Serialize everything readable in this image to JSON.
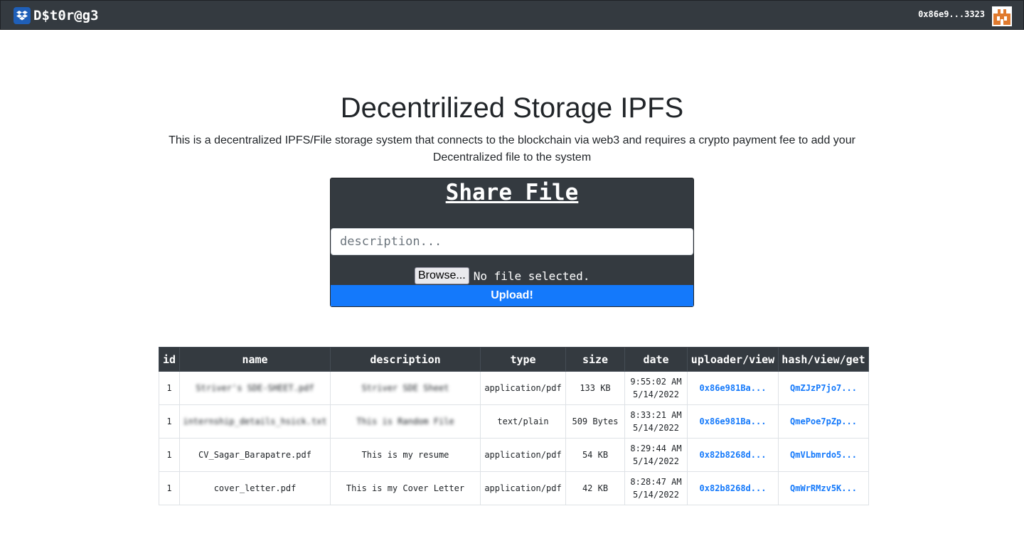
{
  "navbar": {
    "brand": "D$t0r@g3",
    "account": "0x86e9...3323"
  },
  "main": {
    "title": "Decentrilized Storage IPFS",
    "description": "This is a decentralized IPFS/File storage system that connects to the blockchain via web3 and requires a crypto payment fee to add your Decentralized file to the system"
  },
  "share_form": {
    "title": "Share File",
    "description_placeholder": "description...",
    "description_value": "",
    "browse_label": "Browse...",
    "file_status": "No file selected.",
    "upload_label": "Upload!"
  },
  "table": {
    "headers": [
      "id",
      "name",
      "description",
      "type",
      "size",
      "date",
      "uploader/view",
      "hash/view/get"
    ],
    "rows": [
      {
        "id": "1",
        "name": "Striver's SDE-SHEET.pdf",
        "description": "Striver SDE Sheet",
        "type": "application/pdf",
        "size": "133 KB",
        "time": "9:55:02 AM",
        "date": "5/14/2022",
        "uploader": "0x86e981Ba...",
        "hash": "QmZJzP7jo7..."
      },
      {
        "id": "1",
        "name": "internship_details_hsick.txt",
        "description": "This is Random File",
        "type": "text/plain",
        "size": "509 Bytes",
        "time": "8:33:21 AM",
        "date": "5/14/2022",
        "uploader": "0x86e981Ba...",
        "hash": "QmePoe7pZp..."
      },
      {
        "id": "1",
        "name": "CV_Sagar_Barapatre.pdf",
        "description": "This is my resume",
        "type": "application/pdf",
        "size": "54 KB",
        "time": "8:29:44 AM",
        "date": "5/14/2022",
        "uploader": "0x82b8268d...",
        "hash": "QmVLbmrdo5..."
      },
      {
        "id": "1",
        "name": "cover_letter.pdf",
        "description": "This is my Cover Letter",
        "type": "application/pdf",
        "size": "42 KB",
        "time": "8:28:47 AM",
        "date": "5/14/2022",
        "uploader": "0x82b8268d...",
        "hash": "QmWrRMzv5K..."
      }
    ]
  },
  "colors": {
    "navbar_bg": "#343a40",
    "primary": "#1479fb",
    "avatar_accent": "#e07a2e"
  },
  "icons": {
    "brand": "dropbox-icon",
    "account": "identicon-avatar"
  }
}
